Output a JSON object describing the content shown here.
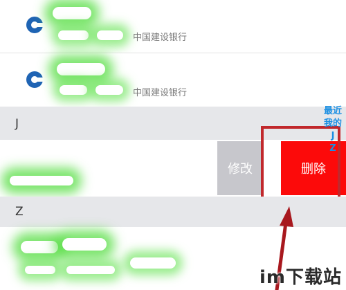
{
  "contacts_top": [
    {
      "bank": "中国建设银行",
      "icon": "ccb-bank-logo-icon"
    },
    {
      "bank": "中国建设银行",
      "icon": "ccb-bank-logo-icon"
    }
  ],
  "sections": [
    {
      "letter": "J"
    },
    {
      "letter": "Z"
    }
  ],
  "swipe_actions": {
    "edit_label": "修改",
    "delete_label": "删除"
  },
  "index_bar": [
    "最近",
    "我的",
    "J",
    "Z"
  ],
  "watermark": "im下载站",
  "colors": {
    "delete": "#fc0a0a",
    "edit": "#c7c7cc",
    "highlight": "#c1282c",
    "index": "#1a8fe3",
    "brand_ccb": "#1f64b4"
  }
}
